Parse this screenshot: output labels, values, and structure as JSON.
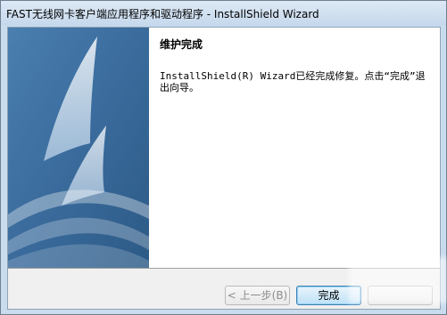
{
  "window": {
    "title": "FAST无线网卡客户端应用程序和驱动程序 - InstallShield Wizard"
  },
  "content": {
    "heading": "维护完成",
    "message": "InstallShield(R) Wizard已经完成修复。点击“完成”退出向导。"
  },
  "buttons": {
    "back_label": "< 上一步(B)",
    "finish_label": "完成",
    "cancel_label": ""
  },
  "colors": {
    "panel_blue": "#3c6fa0",
    "panel_dark": "#2b5684",
    "button_accent": "#3c7fb1"
  },
  "icons": {
    "side_art": "swoosh-graphic"
  }
}
